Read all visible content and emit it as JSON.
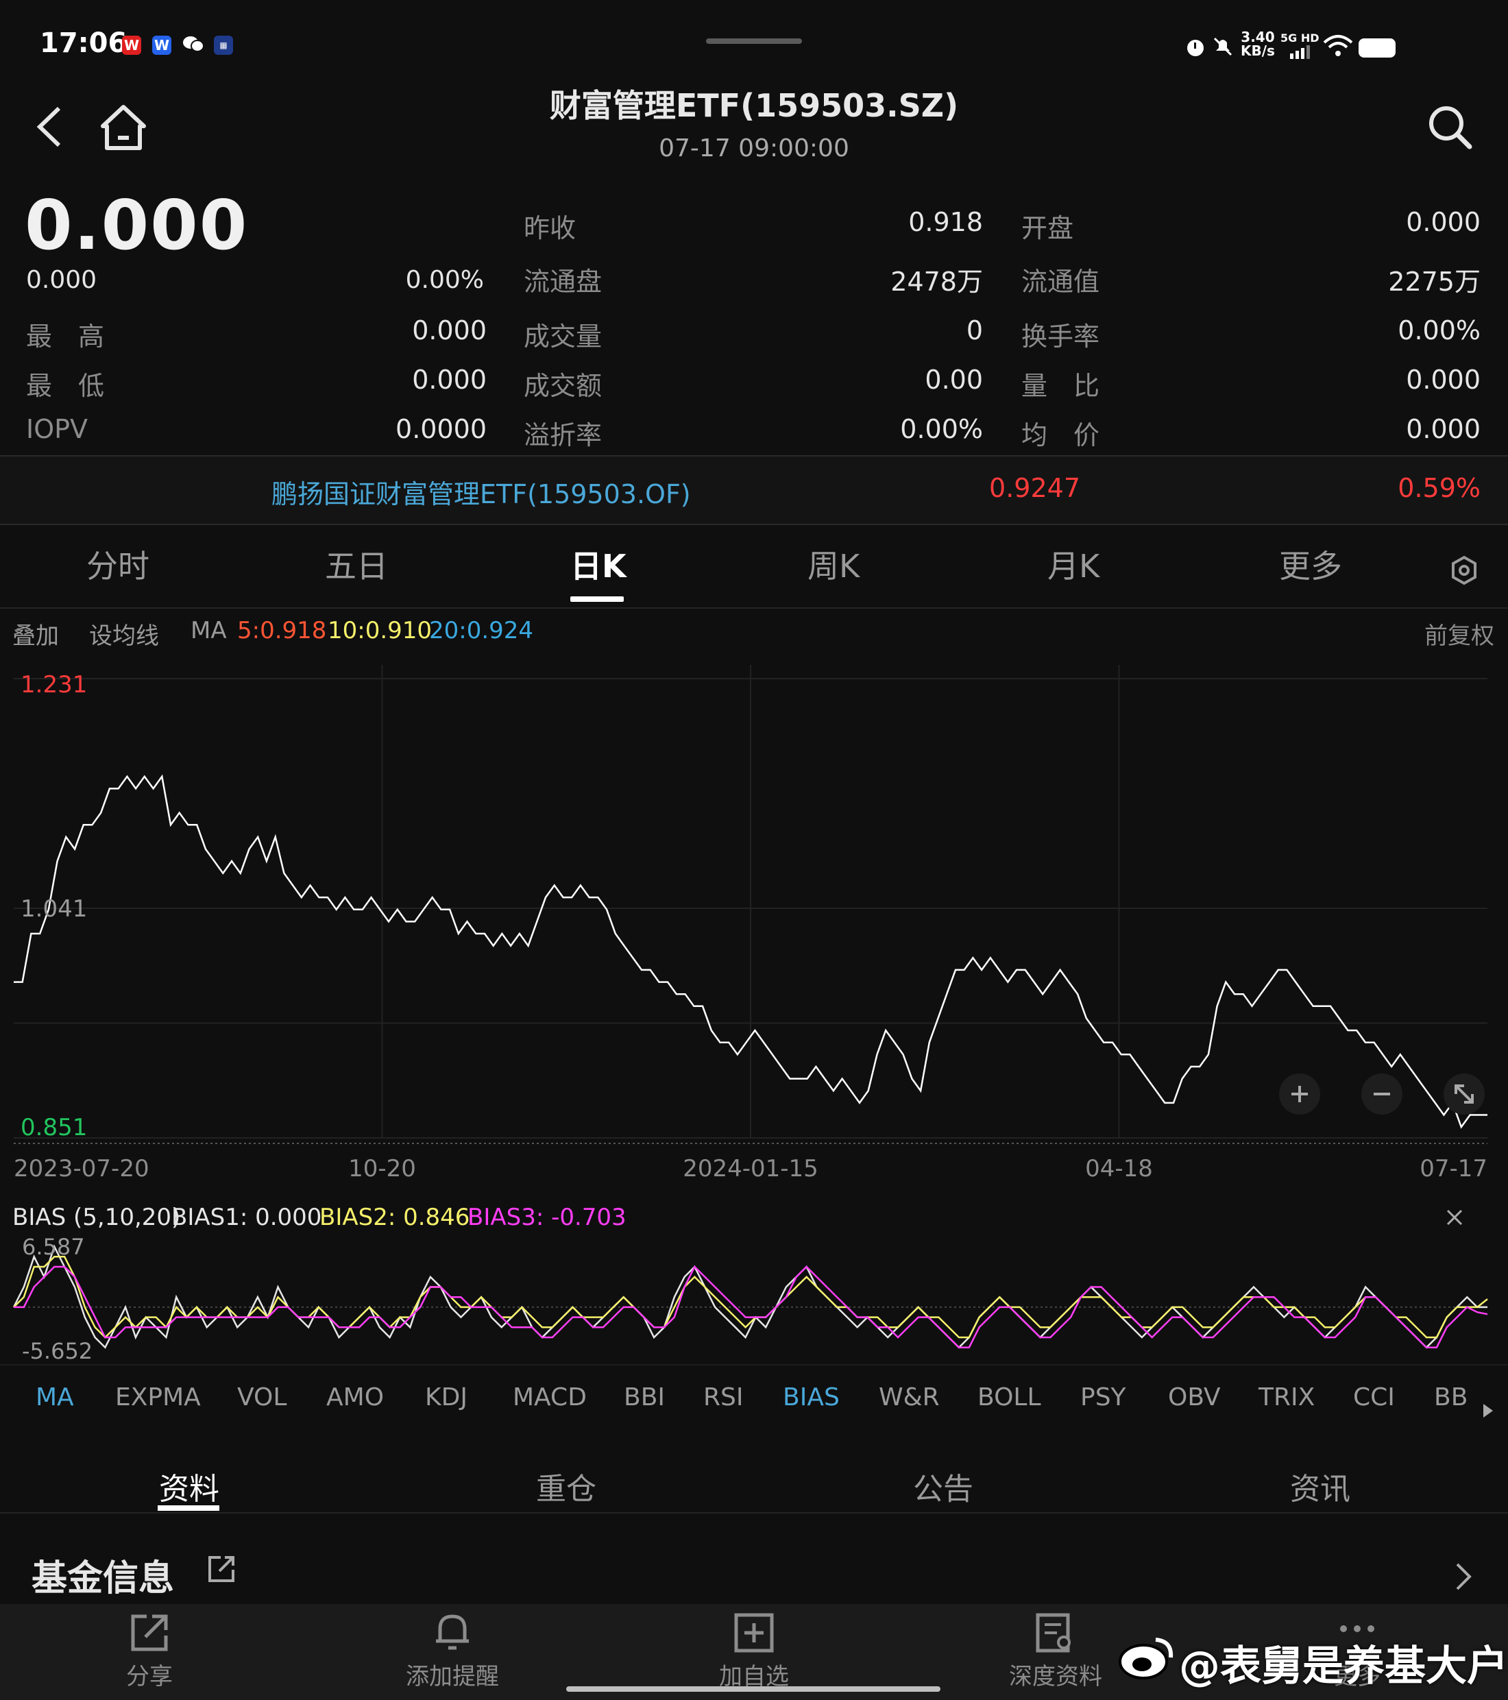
{
  "status_bar": {
    "time": "17:06",
    "net_speed_value": "3.40",
    "net_speed_unit": "KB/s",
    "network": "5G HD"
  },
  "header": {
    "title": "财富管理ETF(159503.SZ)",
    "datetime": "07-17 09:00:00"
  },
  "quote": {
    "price": "0.000",
    "change": "0.000",
    "change_pct": "0.00%",
    "rows": [
      {
        "l1": "最　高",
        "v1": "0.000",
        "l2": "昨收",
        "v2": "0.918",
        "l3": "开盘",
        "v3": "0.000"
      },
      {
        "l1": "",
        "v1": "",
        "l2": "流通盘",
        "v2": "2478万",
        "l3": "流通值",
        "v3": "2275万"
      },
      {
        "l1": "最　高",
        "v1": "0.000",
        "l2": "成交量",
        "v2": "0",
        "l3": "换手率",
        "v3": "0.00%"
      },
      {
        "l1": "最　低",
        "v1": "0.000",
        "l2": "成交额",
        "v2": "0.00",
        "l3": "量　比",
        "v3": "0.000"
      },
      {
        "l1": "IOPV",
        "v1": "0.0000",
        "l2": "溢折率",
        "v2": "0.00%",
        "l3": "均　价",
        "v3": "0.000"
      }
    ]
  },
  "fund_link": {
    "name": "鹏扬国证财富管理ETF(159503.OF)",
    "value": "0.9247",
    "pct": "0.59%"
  },
  "chart_tabs": [
    "分时",
    "五日",
    "日K",
    "周K",
    "月K",
    "更多"
  ],
  "active_chart_tab": "日K",
  "ma_bar": {
    "overlay": "叠加",
    "set_ma": "设均线",
    "ma_label": "MA",
    "ma5": "5:0.918",
    "ma10": "10:0.910",
    "ma20": "20:0.924",
    "adjust": "前复权"
  },
  "chart_data": [
    {
      "type": "line",
      "name": "price",
      "ylim": [
        0.851,
        1.231
      ],
      "y_ticks": [
        "1.231",
        "1.041",
        "0.851"
      ],
      "x_ticks": [
        "2023-07-20",
        "10-20",
        "2024-01-15",
        "04-18",
        "07-17"
      ],
      "values": [
        0.98,
        0.98,
        1.02,
        1.02,
        1.04,
        1.08,
        1.1,
        1.09,
        1.11,
        1.11,
        1.12,
        1.14,
        1.14,
        1.15,
        1.14,
        1.15,
        1.14,
        1.15,
        1.11,
        1.12,
        1.11,
        1.11,
        1.09,
        1.08,
        1.07,
        1.08,
        1.07,
        1.09,
        1.1,
        1.08,
        1.1,
        1.07,
        1.06,
        1.05,
        1.06,
        1.05,
        1.05,
        1.04,
        1.05,
        1.04,
        1.04,
        1.05,
        1.04,
        1.03,
        1.04,
        1.03,
        1.03,
        1.04,
        1.05,
        1.04,
        1.04,
        1.02,
        1.03,
        1.02,
        1.02,
        1.01,
        1.02,
        1.01,
        1.02,
        1.01,
        1.03,
        1.05,
        1.06,
        1.05,
        1.05,
        1.06,
        1.05,
        1.05,
        1.04,
        1.02,
        1.01,
        1.0,
        0.99,
        0.99,
        0.98,
        0.98,
        0.97,
        0.97,
        0.96,
        0.96,
        0.94,
        0.93,
        0.93,
        0.92,
        0.93,
        0.94,
        0.93,
        0.92,
        0.91,
        0.9,
        0.9,
        0.9,
        0.91,
        0.9,
        0.89,
        0.9,
        0.89,
        0.88,
        0.89,
        0.92,
        0.94,
        0.93,
        0.92,
        0.9,
        0.89,
        0.93,
        0.95,
        0.97,
        0.99,
        0.99,
        1.0,
        0.99,
        1.0,
        0.99,
        0.98,
        0.99,
        0.99,
        0.98,
        0.97,
        0.98,
        0.99,
        0.98,
        0.97,
        0.95,
        0.94,
        0.93,
        0.93,
        0.92,
        0.92,
        0.91,
        0.9,
        0.89,
        0.88,
        0.88,
        0.9,
        0.91,
        0.91,
        0.92,
        0.96,
        0.98,
        0.97,
        0.97,
        0.96,
        0.97,
        0.98,
        0.99,
        0.99,
        0.98,
        0.97,
        0.96,
        0.96,
        0.96,
        0.95,
        0.94,
        0.94,
        0.93,
        0.93,
        0.92,
        0.91,
        0.92,
        0.91,
        0.9,
        0.89,
        0.88,
        0.87,
        0.88,
        0.86,
        0.87,
        0.87,
        0.87
      ],
      "grid": true
    },
    {
      "type": "line",
      "name": "BIAS",
      "ylim": [
        -5.652,
        6.587
      ],
      "y_ticks": [
        "6.587",
        "-5.652"
      ],
      "series": [
        {
          "name": "BIAS1: 0.000",
          "color": "#e6e6e6",
          "values": [
            0,
            2,
            5,
            3,
            6,
            4,
            2,
            -1,
            -3,
            -4,
            -2,
            0,
            -3,
            -1,
            -2,
            -3,
            1,
            -1,
            0,
            -2,
            -1,
            0,
            -2,
            -1,
            1,
            -1,
            2,
            0,
            -1,
            -2,
            0,
            -1,
            -3,
            -2,
            -1,
            0,
            -2,
            -3,
            -1,
            -2,
            1,
            3,
            2,
            0,
            -1,
            0,
            1,
            -1,
            -2,
            -1,
            0,
            -2,
            -3,
            -2,
            -1,
            0,
            -1,
            -2,
            -1,
            0,
            1,
            0,
            -1,
            -3,
            -2,
            1,
            3,
            4,
            2,
            0,
            -1,
            -2,
            -3,
            -1,
            -2,
            0,
            2,
            3,
            4,
            2,
            1,
            0,
            -1,
            -2,
            -1,
            -2,
            -3,
            -2,
            -1,
            0,
            -1,
            -2,
            -3,
            -4,
            -3,
            -1,
            0,
            1,
            0,
            -1,
            -2,
            -3,
            -2,
            -1,
            0,
            1,
            2,
            1,
            0,
            -1,
            -2,
            -3,
            -2,
            -1,
            0,
            -1,
            -2,
            -3,
            -2,
            -1,
            0,
            1,
            2,
            1,
            0,
            -1,
            0,
            -1,
            -2,
            -3,
            -2,
            -1,
            0,
            2,
            1,
            0,
            -1,
            -2,
            -3,
            -4,
            -3,
            -1,
            0,
            1,
            0,
            0
          ]
        },
        {
          "name": "BIAS2: 0.846",
          "color": "#f5f06a",
          "values": [
            0,
            1,
            4,
            4,
            5,
            5,
            3,
            0,
            -2,
            -3,
            -2,
            -1,
            -2,
            -1,
            -1,
            -2,
            0,
            -1,
            0,
            -1,
            -1,
            0,
            -1,
            -1,
            0,
            -1,
            1,
            0,
            -1,
            -1,
            0,
            -1,
            -2,
            -2,
            -1,
            0,
            -1,
            -2,
            -1,
            -1,
            1,
            2,
            2,
            1,
            0,
            0,
            1,
            0,
            -1,
            -1,
            0,
            -1,
            -2,
            -2,
            -1,
            0,
            -1,
            -1,
            -1,
            0,
            1,
            0,
            -1,
            -2,
            -2,
            0,
            2,
            3,
            2,
            1,
            0,
            -1,
            -2,
            -1,
            -1,
            0,
            1,
            2,
            3,
            2,
            1,
            0,
            0,
            -1,
            -1,
            -1,
            -2,
            -2,
            -1,
            0,
            -1,
            -1,
            -2,
            -3,
            -3,
            -1,
            0,
            1,
            0,
            0,
            -1,
            -2,
            -2,
            -1,
            0,
            1,
            1,
            1,
            0,
            -1,
            -1,
            -2,
            -2,
            -1,
            0,
            0,
            -1,
            -2,
            -2,
            -1,
            0,
            1,
            1,
            1,
            0,
            0,
            0,
            -1,
            -1,
            -2,
            -2,
            -1,
            0,
            1,
            1,
            0,
            -1,
            -1,
            -2,
            -3,
            -3,
            -1,
            0,
            0,
            0,
            0.8
          ]
        },
        {
          "name": "BIAS3: -0.703",
          "color": "#ff3ef5",
          "values": [
            0,
            0,
            2,
            3,
            4,
            4,
            3,
            1,
            -1,
            -3,
            -3,
            -2,
            -2,
            -2,
            -2,
            -2,
            -1,
            -1,
            -1,
            -1,
            -1,
            -1,
            -1,
            -1,
            -1,
            -1,
            0,
            0,
            -1,
            -1,
            -1,
            -1,
            -2,
            -2,
            -2,
            -1,
            -1,
            -2,
            -2,
            -1,
            0,
            2,
            2,
            1,
            1,
            0,
            0,
            0,
            -1,
            -2,
            -2,
            -2,
            -3,
            -3,
            -2,
            -1,
            -1,
            -2,
            -2,
            -1,
            0,
            0,
            -1,
            -2,
            -2,
            -1,
            2,
            4,
            3,
            2,
            1,
            0,
            -1,
            -1,
            -1,
            0,
            1,
            3,
            4,
            3,
            2,
            1,
            0,
            -1,
            -1,
            -2,
            -2,
            -3,
            -2,
            -1,
            -1,
            -2,
            -3,
            -4,
            -4,
            -2,
            -1,
            0,
            0,
            -1,
            -2,
            -3,
            -3,
            -2,
            -1,
            1,
            2,
            2,
            1,
            0,
            -1,
            -2,
            -3,
            -2,
            -1,
            -1,
            -2,
            -3,
            -3,
            -2,
            -1,
            0,
            1,
            1,
            1,
            0,
            -1,
            -1,
            -2,
            -3,
            -3,
            -2,
            -1,
            1,
            1,
            0,
            -1,
            -2,
            -3,
            -4,
            -4,
            -2,
            -1,
            0,
            -0.5,
            -0.7
          ]
        }
      ]
    }
  ],
  "bias_bar": {
    "label": "BIAS (5,10,20)",
    "bias1": "BIAS1: 0.000",
    "bias2": "BIAS2: 0.846",
    "bias3": "BIAS3: -0.703"
  },
  "indicators": [
    "MA",
    "EXPMA",
    "VOL",
    "AMO",
    "KDJ",
    "MACD",
    "BBI",
    "RSI",
    "BIAS",
    "W&R",
    "BOLL",
    "PSY",
    "OBV",
    "TRIX",
    "CCI",
    "BB"
  ],
  "active_indicators": [
    "MA",
    "BIAS"
  ],
  "info_tabs": [
    "资料",
    "重仓",
    "公告",
    "资讯"
  ],
  "active_info_tab": "资料",
  "section_title": "基金信息",
  "bottom_bar": [
    "分享",
    "添加提醒",
    "加自选",
    "深度资料",
    "更多"
  ],
  "watermark": "@表舅是养基大户",
  "colors": {
    "up": "#ff3b3b",
    "down": "#22c55e",
    "link": "#4aa8d8",
    "ma5": "#ff5533",
    "ma10": "#f5f06a",
    "ma20": "#3aa9e0",
    "bias3": "#ff3ef5"
  }
}
